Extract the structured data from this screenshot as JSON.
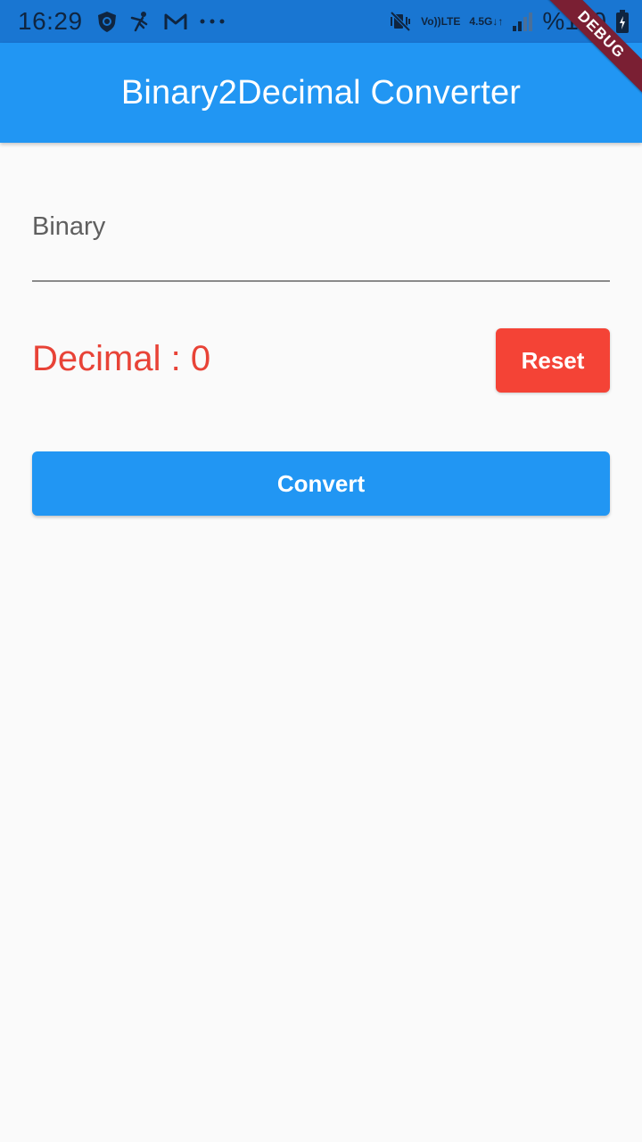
{
  "status_bar": {
    "time": "16:29",
    "left_icons": [
      "shield-lion-icon",
      "fencing-icon",
      "gmail-icon",
      "more-dots-icon"
    ],
    "volte_line1": "Vo))",
    "volte_line2": "LTE",
    "network_type": "4.5G",
    "battery": "%100"
  },
  "app_bar": {
    "title": "Binary2Decimal Converter"
  },
  "debug_banner": "DEBUG",
  "binary_field": {
    "placeholder": "Binary",
    "value": ""
  },
  "result": {
    "label": "Decimal : 0"
  },
  "buttons": {
    "reset": "Reset",
    "convert": "Convert"
  },
  "colors": {
    "status_bar": "#1976d2",
    "app_bar": "#2196f3",
    "reset_button": "#f44336",
    "convert_button": "#2196f3",
    "decimal_text": "#e84337",
    "background": "#fafafa"
  }
}
